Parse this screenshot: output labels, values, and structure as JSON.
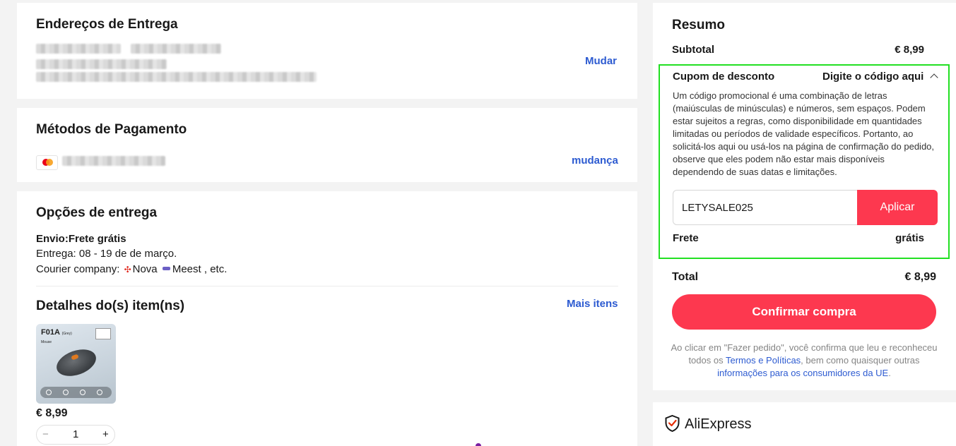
{
  "address": {
    "title": "Endereços de Entrega",
    "change_link": "Mudar"
  },
  "payment": {
    "title": "Métodos de Pagamento",
    "change_link": "mudança",
    "card_icon": "mastercard-icon"
  },
  "delivery": {
    "title": "Opções de entrega",
    "shipping_label": "Envio:",
    "shipping_value": "Frete grátis",
    "eta": "Entrega: 08 - 19 de de março.",
    "courier_label": "Courier company:",
    "courier_1": "Nova",
    "courier_2": "Meest",
    "courier_suffix": ", etc."
  },
  "items": {
    "title": "Detalhes do(s) item(ns)",
    "more_link": "Mais itens",
    "product": {
      "image_title": "F01A",
      "image_subtitle": "(Grey)",
      "image_tag": "Mouse",
      "price": "€ 8,99",
      "quantity": "1",
      "minus": "−",
      "plus": "+"
    }
  },
  "summary": {
    "title": "Resumo",
    "subtotal_label": "Subtotal",
    "subtotal_value": "€ 8,99",
    "coupon_label": "Cupom de desconto",
    "coupon_toggle": "Digite o código aqui",
    "coupon_description": "Um código promocional é uma combinação de letras (maiúsculas de minúsculas) e números, sem espaços. Podem estar sujeitos a regras, como disponibilidade em quantidades limitadas ou períodos de validade específicos. Portanto, ao solicitá-los aqui ou usá-los na página de confirmação do pedido, observe que eles podem não estar mais disponíveis dependendo de suas datas e limitações.",
    "coupon_input_value": "LETYSALE025",
    "apply_button": "Aplicar",
    "shipping_label": "Frete",
    "shipping_value": "grátis",
    "total_label": "Total",
    "total_value": "€ 8,99",
    "confirm_button": "Confirmar compra",
    "legal_1": "Ao clicar em \"Fazer pedido\", você confirma que leu e reconheceu todos os ",
    "legal_link_1": "Termos e Políticas",
    "legal_2": ", bem como quaisquer outras ",
    "legal_link_2": "informações para os consumidores da UE",
    "legal_3": "."
  },
  "brand": {
    "name": "AliExpress",
    "logo_icon": "shield-check-icon"
  },
  "colors": {
    "accent": "#fd384f",
    "link": "#2d5bd1",
    "highlight": "#22e022"
  }
}
